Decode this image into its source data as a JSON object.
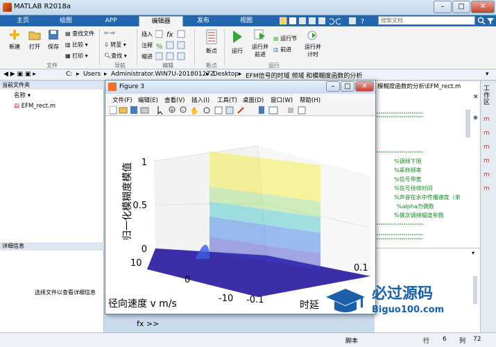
{
  "window": {
    "title": "MATLAB R2018a",
    "min": "–",
    "max": "□",
    "close": "✕"
  },
  "tabs": [
    "主页",
    "绘图",
    "APP",
    "编辑器",
    "发布",
    "视图"
  ],
  "search": {
    "placeholder": "搜索文档"
  },
  "ribbon": {
    "new": "新建",
    "open": "打开",
    "save": "保存",
    "find_files": "查找文件",
    "compare": "比较",
    "print": "打印",
    "goto": "转至",
    "find": "查找",
    "insert": "插入",
    "comment": "注释",
    "indent": "缩进",
    "fx": "fx",
    "breakpoints": "断点",
    "run": "运行",
    "run_advance_1": "运行并",
    "run_advance_2": "前进",
    "run_section": "运行节",
    "advance": "前进",
    "run_time_1": "运行并",
    "run_time_2": "计时",
    "groups": {
      "file": "文件",
      "nav": "导航",
      "edit": "编辑",
      "bp": "断点",
      "run": "运行"
    }
  },
  "address": {
    "path": [
      "C:",
      "Users",
      "Administrator.WIN7U-20180127Z",
      "Desktop",
      "EFM信号的时域 频域 和模糊度函数的分析"
    ],
    "editor_path": "模糊度函数的分析\\EFM_rect.m"
  },
  "current_folder": {
    "header": "当前文件夹",
    "column": "名称 ▾",
    "files": [
      "EFM_rect.m"
    ]
  },
  "details": {
    "header": "详细信息",
    "hint": "选择文件以查看详细信息"
  },
  "editor": {
    "lines": [
      "%调频下限",
      "%采样频率",
      "%信号带宽",
      "%信号持续时间",
      "%声音在水中传播速度（单",
      "%alpha为偶数",
      "%偶次调频幅度参数"
    ]
  },
  "right_panel": {
    "label": "工作区"
  },
  "command": {
    "prompt": "fx >>"
  },
  "status": {
    "script": "脚本",
    "row_label": "行",
    "row": "6",
    "col_label": "列",
    "col": "72"
  },
  "figure": {
    "title": "Figure 3",
    "menus": [
      "文件(F)",
      "编辑(E)",
      "查看(V)",
      "插入(I)",
      "工具(T)",
      "桌面(D)",
      "窗口(W)",
      "帮助(H)"
    ],
    "zlabel": "归一化模糊度模值",
    "xlabel": "径向速度 v   m/s",
    "ylabel": "时延",
    "zticks": [
      "0",
      "0.5",
      "1"
    ],
    "xticks": [
      "10",
      "0",
      "-10"
    ],
    "yticks": [
      "-0.1",
      "0.1"
    ]
  },
  "watermark": {
    "text": "必过源码",
    "url": "Biguo100.com"
  },
  "chart_data": {
    "type": "surface",
    "xlabel": "径向速度 v   m/s",
    "ylabel": "时延",
    "zlabel": "归一化模糊度模值",
    "xlim": [
      -10,
      10
    ],
    "ylim": [
      -0.1,
      0.1
    ],
    "zlim": [
      0,
      1
    ],
    "description_peak": {
      "v": 0,
      "tau": 0,
      "value": 1
    }
  },
  "colors": {
    "tabbar": "#2466ad",
    "surface_low": "#3a2fa8",
    "surface_high": "#f3ea2b"
  }
}
